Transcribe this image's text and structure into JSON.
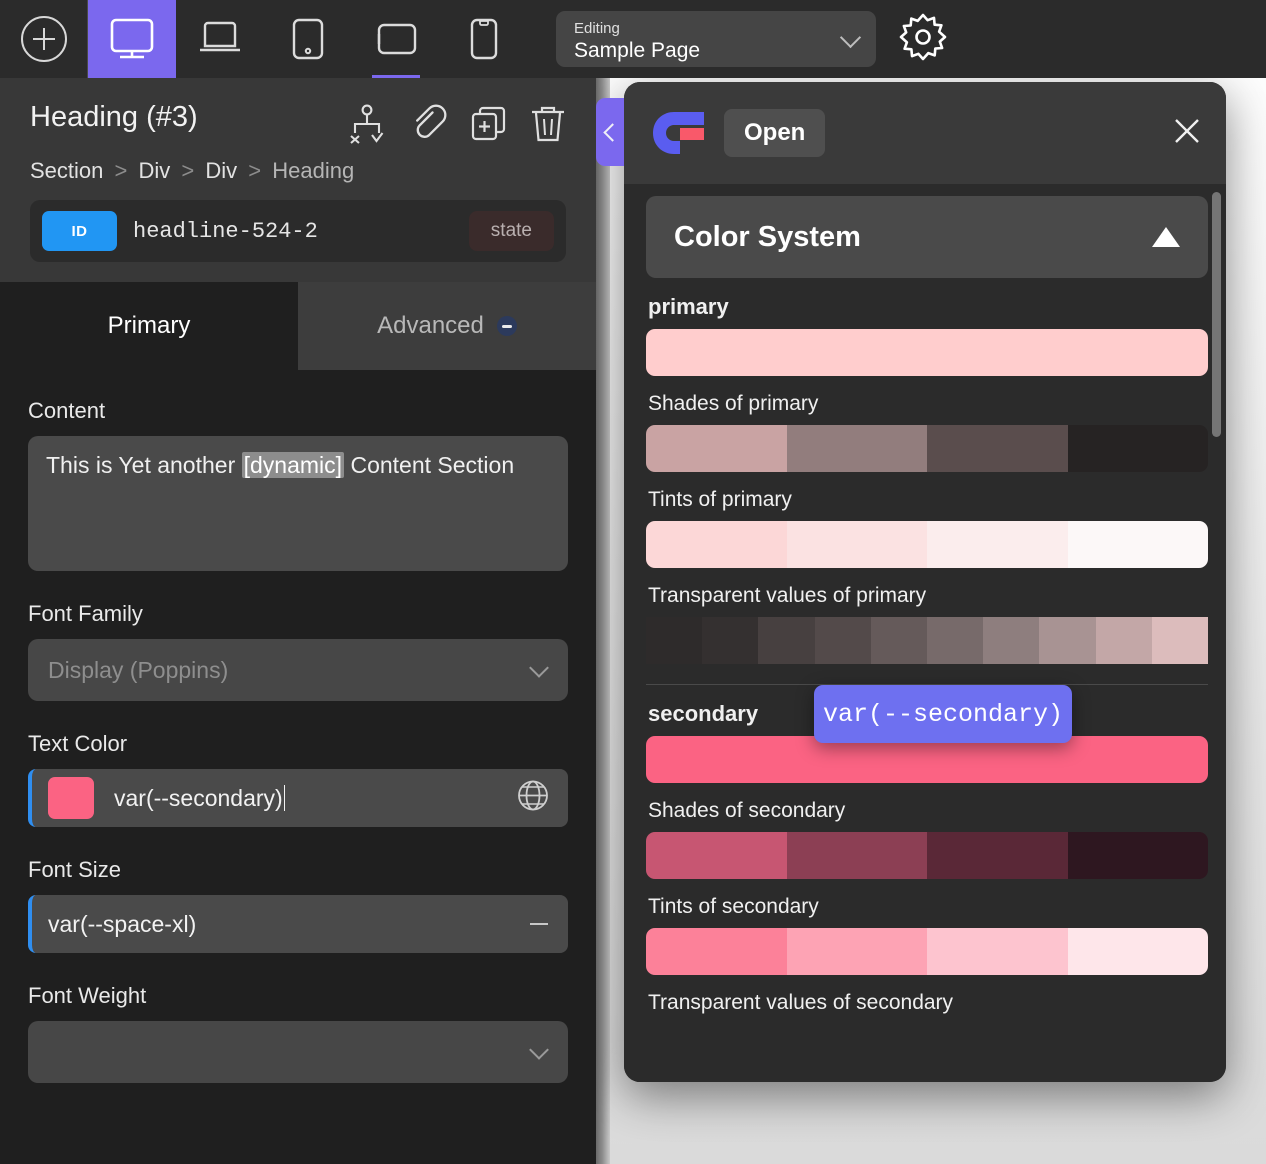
{
  "topbar": {
    "add_button": "add-new",
    "devices": [
      {
        "name": "desktop",
        "icon": "monitor-icon",
        "active": true,
        "underline": false
      },
      {
        "name": "laptop",
        "icon": "laptop-icon",
        "active": false,
        "underline": false
      },
      {
        "name": "tablet",
        "icon": "tablet-icon",
        "active": false,
        "underline": false
      },
      {
        "name": "tablet-landscape",
        "icon": "tablet-landscape-icon",
        "active": false,
        "underline": true
      },
      {
        "name": "mobile",
        "icon": "mobile-icon",
        "active": false,
        "underline": false
      }
    ],
    "page_select": {
      "label": "Editing",
      "value": "Sample Page"
    },
    "settings_icon": "gear-icon"
  },
  "inspector": {
    "title": "Heading (#3)",
    "actions": [
      {
        "name": "conditions-icon",
        "label": "conditions"
      },
      {
        "name": "link-icon",
        "label": "link"
      },
      {
        "name": "duplicate-icon",
        "label": "duplicate"
      },
      {
        "name": "trash-icon",
        "label": "delete"
      }
    ],
    "breadcrumb": [
      "Section",
      "Div",
      "Div",
      "Heading"
    ],
    "id_badge": "ID",
    "id_value": "headline-524-2",
    "state_chip": "state",
    "tabs": [
      {
        "label": "Primary",
        "selected": true
      },
      {
        "label": "Advanced",
        "selected": false,
        "badge": "dash"
      }
    ],
    "fields": {
      "content": {
        "label": "Content",
        "value_before": "This is Yet another ",
        "value_token": "[dynamic]",
        "value_after": " Content Section"
      },
      "font_family": {
        "label": "Font Family",
        "placeholder": "Display (Poppins)",
        "value": ""
      },
      "text_color": {
        "label": "Text Color",
        "value": "var(--secondary)",
        "swatch": "#fb6383",
        "icon": "globe-icon"
      },
      "font_size": {
        "label": "Font Size",
        "value": "var(--space-xl)",
        "icon": "minus-icon"
      },
      "font_weight": {
        "label": "Font Weight",
        "value": ""
      }
    }
  },
  "panel_toggle": {
    "name": "collapse-panel",
    "icon": "chevron-left-icon"
  },
  "modal": {
    "logo": "logo-icon",
    "open_button": "Open",
    "close_icon": "close-icon",
    "section": {
      "title": "Color System",
      "expanded": true,
      "icon": "triangle-up-icon"
    },
    "groups": [
      {
        "name": "primary",
        "label": "primary",
        "bold": true,
        "swatches": [
          "#FFCDCD"
        ]
      },
      {
        "name": "shades-of-primary",
        "label": "Shades of primary",
        "bold": false,
        "swatches": [
          "#C9A3A3",
          "#927D7D",
          "#5A4D4D",
          "#262323"
        ]
      },
      {
        "name": "tints-of-primary",
        "label": "Tints of primary",
        "bold": false,
        "swatches": [
          "#FCD7D7",
          "#FBE2E2",
          "#FBEDED",
          "#FCF8F8"
        ]
      },
      {
        "name": "transparent-values-of-primary",
        "label": "Transparent values of primary",
        "bold": false,
        "swatches": [
          "#2E2B2B",
          "#343030",
          "#474040",
          "#534A4A",
          "#655A5A",
          "#776A6A",
          "#8E7E7E",
          "#A89393",
          "#C3A7A7",
          "#DCBCBC"
        ]
      }
    ],
    "groups2": [
      {
        "name": "secondary",
        "label": "secondary",
        "bold": true,
        "swatches": [
          "#FB6383"
        ]
      },
      {
        "name": "shades-of-secondary",
        "label": "Shades of secondary",
        "bold": false,
        "swatches": [
          "#C75672",
          "#8C3F54",
          "#5A2837",
          "#2E1720"
        ]
      },
      {
        "name": "tints-of-secondary",
        "label": "Tints of secondary",
        "bold": false,
        "swatches": [
          "#FC8199",
          "#FDA3B4",
          "#FDC4CF",
          "#FEE6EA"
        ]
      },
      {
        "name": "transparent-values-of-secondary",
        "label": "Transparent values of secondary",
        "bold": false,
        "swatches": []
      }
    ],
    "scrollbar": {
      "name": "modal-scrollbar"
    }
  },
  "tooltip": {
    "text": "var(--secondary)"
  }
}
